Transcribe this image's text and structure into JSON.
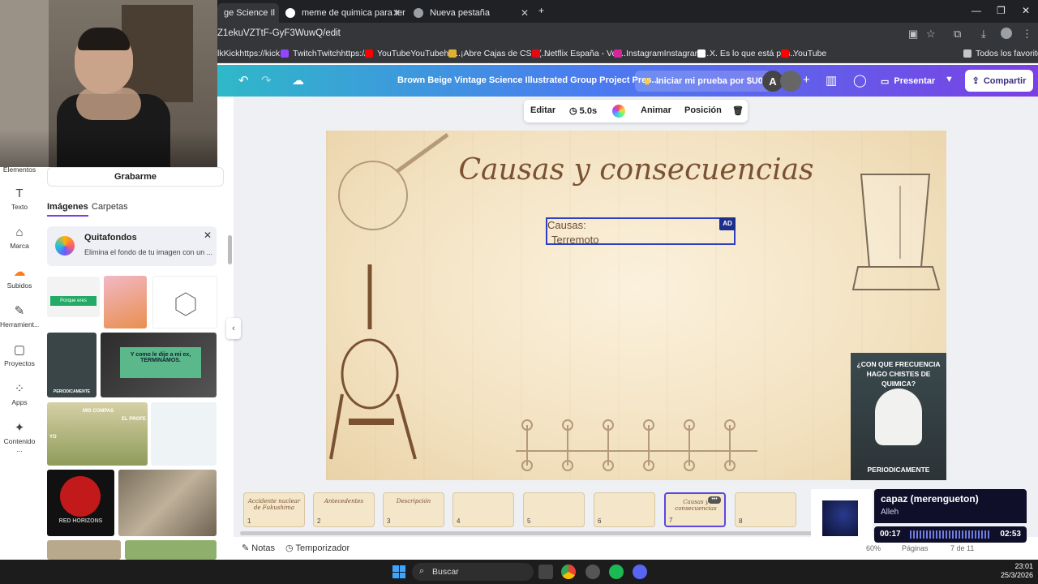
{
  "browser": {
    "tabs": [
      {
        "title": "ge Science Il",
        "active": true
      },
      {
        "title": "meme de quimica para termina",
        "active": false
      },
      {
        "title": "Nueva pestaña",
        "active": false
      }
    ],
    "new_tab": "+",
    "url": "Z1ekuVZTtF-GyF3WuwQ/edit",
    "bookmarks": [
      {
        "label": "lkKickhttps://kick...",
        "color": "#53fc18"
      },
      {
        "label": "TwitchTwitchhttps://...",
        "color": "#9146ff"
      },
      {
        "label": "YouTubeYouTubehtt...",
        "color": "#ff0000"
      },
      {
        "label": "¡Abre Cajas de CS2 (...",
        "color": "#e0b030"
      },
      {
        "label": "Netflix España - Ver...",
        "color": "#e50914"
      },
      {
        "label": "InstagramInstagram...",
        "color": "#d6249f"
      },
      {
        "label": "X. Es lo que está pas...",
        "color": "#ffffff"
      },
      {
        "label": "YouTube",
        "color": "#ff0000"
      }
    ],
    "all_bookmarks": "Todos los favoritos"
  },
  "canva": {
    "title": "Brown Beige Vintage Science Illustrated Group Project Pres...",
    "trial_button": "Iniciar mi prueba por $U0",
    "avatar_letter": "A",
    "present_button": "Presentar",
    "share_button": "Compartir",
    "accent": "#7b3fe4"
  },
  "rail": [
    {
      "label": "Elementos",
      "icon": "elements-icon"
    },
    {
      "label": "Texto",
      "icon": "text-icon"
    },
    {
      "label": "Marca",
      "icon": "brand-icon"
    },
    {
      "label": "Subidos",
      "icon": "uploads-icon"
    },
    {
      "label": "Herramient...",
      "icon": "tools-icon"
    },
    {
      "label": "Proyectos",
      "icon": "projects-icon"
    },
    {
      "label": "Apps",
      "icon": "apps-icon"
    },
    {
      "label": "Contenido ...",
      "icon": "content-icon"
    }
  ],
  "panel": {
    "record_button": "Grabarme",
    "tabs": [
      "Imágenes",
      "Carpetas"
    ],
    "promo_title": "Quitafondos",
    "promo_desc": "Elimina el fondo de tu imagen con un ...",
    "thumb_captions": {
      "perfecta_top": "Porque eres",
      "cat_caption": "PERIODICAMENTE",
      "tv_text": "Y como le dije a mi ex, TERMINAMOS.",
      "compas_left": "YO",
      "compas_mid": "MIS COMPAS",
      "compas_right": "EL PROFE",
      "red_title": "RED HORIZONS"
    }
  },
  "toolbar": {
    "edit": "Editar",
    "duration": "5.0s",
    "animate": "Animar",
    "position": "Posición"
  },
  "slide": {
    "title": "Causas y consecuencias",
    "textbox_line1": "Causas:",
    "textbox_line2": " Terremoto",
    "badge": "AD",
    "meme_top": "¿CON QUE FRECUENCIA HAGO CHISTES DE QUIMICA?",
    "meme_bottom": "PERIODICAMENTE"
  },
  "filmstrip": [
    {
      "num": "1",
      "title": "Accidente nuclear de Fukushima"
    },
    {
      "num": "2",
      "title": "Antecedentes"
    },
    {
      "num": "3",
      "title": "Descripción"
    },
    {
      "num": "4",
      "title": ""
    },
    {
      "num": "5",
      "title": ""
    },
    {
      "num": "6",
      "title": ""
    },
    {
      "num": "7",
      "title": "Causas y consecuencias",
      "selected": true
    },
    {
      "num": "8",
      "title": ""
    }
  ],
  "status": {
    "notes": "Notas",
    "timer": "Temporizador",
    "zoom": "60%",
    "pages": "Páginas",
    "page_of": "7 de 11"
  },
  "music": {
    "song": "capaz (merengueton)",
    "artist": "Alleh",
    "current": "00:17",
    "total": "02:53",
    "progress": 0.1
  },
  "taskbar": {
    "search": "Buscar",
    "time": "23:01",
    "date": "25/3/2026"
  }
}
